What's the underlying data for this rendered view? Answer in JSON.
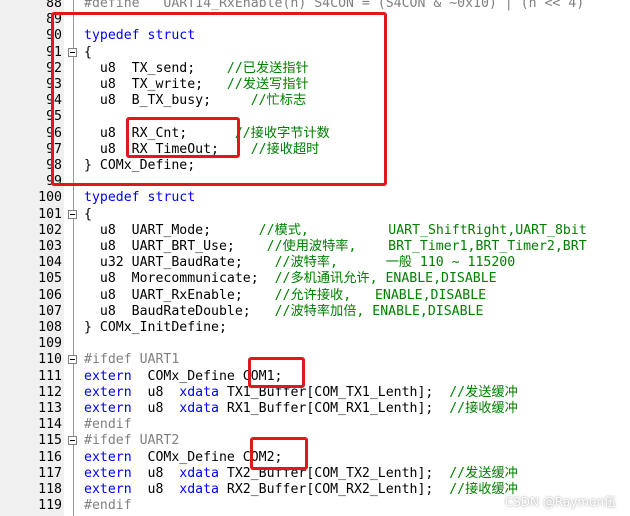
{
  "editor": {
    "lines": [
      {
        "num": "88",
        "fold": false,
        "segs": [
          {
            "t": "#define   UART14_RxEnable(n) S4CON = (S4CON & ~0x10) | (n << 4)",
            "c": "pp"
          }
        ]
      },
      {
        "num": "89",
        "fold": false,
        "segs": []
      },
      {
        "num": "90",
        "fold": false,
        "segs": [
          {
            "t": "typedef struct",
            "c": "kw"
          }
        ]
      },
      {
        "num": "91",
        "fold": true,
        "segs": [
          {
            "t": "{",
            "c": ""
          }
        ]
      },
      {
        "num": "92",
        "fold": false,
        "segs": [
          {
            "t": "  u8  TX_send;    ",
            "c": ""
          },
          {
            "t": "//已发送指针",
            "c": "cmt"
          }
        ]
      },
      {
        "num": "93",
        "fold": false,
        "segs": [
          {
            "t": "  u8  TX_write;   ",
            "c": ""
          },
          {
            "t": "//发送写指针",
            "c": "cmt"
          }
        ]
      },
      {
        "num": "94",
        "fold": false,
        "segs": [
          {
            "t": "  u8  B_TX_busy;     ",
            "c": ""
          },
          {
            "t": "//忙标志",
            "c": "cmt"
          }
        ]
      },
      {
        "num": "95",
        "fold": false,
        "segs": []
      },
      {
        "num": "96",
        "fold": false,
        "segs": [
          {
            "t": "  u8  RX_Cnt;      ",
            "c": ""
          },
          {
            "t": "//接收字节计数",
            "c": "cmt"
          }
        ]
      },
      {
        "num": "97",
        "fold": false,
        "segs": [
          {
            "t": "  u8  RX_TimeOut;    ",
            "c": ""
          },
          {
            "t": "//接收超时",
            "c": "cmt"
          }
        ]
      },
      {
        "num": "98",
        "fold": false,
        "segs": [
          {
            "t": "} COMx_Define;",
            "c": ""
          }
        ]
      },
      {
        "num": "99",
        "fold": false,
        "segs": []
      },
      {
        "num": "100",
        "fold": false,
        "segs": [
          {
            "t": "typedef struct",
            "c": "kw"
          }
        ]
      },
      {
        "num": "101",
        "fold": true,
        "segs": [
          {
            "t": "{",
            "c": ""
          }
        ]
      },
      {
        "num": "102",
        "fold": false,
        "segs": [
          {
            "t": "  u8  UART_Mode;      ",
            "c": ""
          },
          {
            "t": "//模式,          UART_ShiftRight,UART_8bit",
            "c": "cmt"
          }
        ]
      },
      {
        "num": "103",
        "fold": false,
        "segs": [
          {
            "t": "  u8  UART_BRT_Use;    ",
            "c": ""
          },
          {
            "t": "//使用波特率,    BRT_Timer1,BRT_Timer2,BRT",
            "c": "cmt"
          }
        ]
      },
      {
        "num": "104",
        "fold": false,
        "segs": [
          {
            "t": "  u32 UART_BaudRate;    ",
            "c": ""
          },
          {
            "t": "//波特率,      一般 110 ~ 115200",
            "c": "cmt"
          }
        ]
      },
      {
        "num": "105",
        "fold": false,
        "segs": [
          {
            "t": "  u8  Morecommunicate;  ",
            "c": ""
          },
          {
            "t": "//多机通讯允许, ENABLE,DISABLE",
            "c": "cmt"
          }
        ]
      },
      {
        "num": "106",
        "fold": false,
        "segs": [
          {
            "t": "  u8  UART_RxEnable;    ",
            "c": ""
          },
          {
            "t": "//允许接收,   ENABLE,DISABLE",
            "c": "cmt"
          }
        ]
      },
      {
        "num": "107",
        "fold": false,
        "segs": [
          {
            "t": "  u8  BaudRateDouble;   ",
            "c": ""
          },
          {
            "t": "//波特率加倍, ENABLE,DISABLE",
            "c": "cmt"
          }
        ]
      },
      {
        "num": "108",
        "fold": false,
        "segs": [
          {
            "t": "} COMx_InitDefine;",
            "c": ""
          }
        ]
      },
      {
        "num": "109",
        "fold": false,
        "segs": []
      },
      {
        "num": "110",
        "fold": true,
        "segs": [
          {
            "t": "#ifdef UART1",
            "c": "pp"
          }
        ]
      },
      {
        "num": "111",
        "fold": false,
        "segs": [
          {
            "t": "extern",
            "c": "kw"
          },
          {
            "t": "  COMx_Define COM1;",
            "c": ""
          }
        ]
      },
      {
        "num": "112",
        "fold": false,
        "segs": [
          {
            "t": "extern",
            "c": "kw"
          },
          {
            "t": "  u8  ",
            "c": ""
          },
          {
            "t": "xdata",
            "c": "kw"
          },
          {
            "t": " TX1_Buffer[COM_TX1_Lenth];  ",
            "c": ""
          },
          {
            "t": "//发送缓冲",
            "c": "cmt"
          }
        ]
      },
      {
        "num": "113",
        "fold": false,
        "segs": [
          {
            "t": "extern",
            "c": "kw"
          },
          {
            "t": "  u8  ",
            "c": ""
          },
          {
            "t": "xdata",
            "c": "kw"
          },
          {
            "t": " RX1_Buffer[COM_RX1_Lenth];  ",
            "c": ""
          },
          {
            "t": "//接收缓冲",
            "c": "cmt"
          }
        ]
      },
      {
        "num": "114",
        "fold": false,
        "segs": [
          {
            "t": "#endif",
            "c": "pp"
          }
        ]
      },
      {
        "num": "115",
        "fold": true,
        "segs": [
          {
            "t": "#ifdef UART2",
            "c": "pp"
          }
        ]
      },
      {
        "num": "116",
        "fold": false,
        "segs": [
          {
            "t": "extern",
            "c": "kw"
          },
          {
            "t": "  COMx_Define COM2;",
            "c": ""
          }
        ]
      },
      {
        "num": "117",
        "fold": false,
        "segs": [
          {
            "t": "extern",
            "c": "kw"
          },
          {
            "t": "  u8  ",
            "c": ""
          },
          {
            "t": "xdata",
            "c": "kw"
          },
          {
            "t": " TX2_Buffer[COM_TX2_Lenth];  ",
            "c": ""
          },
          {
            "t": "//发送缓冲",
            "c": "cmt"
          }
        ]
      },
      {
        "num": "118",
        "fold": false,
        "segs": [
          {
            "t": "extern",
            "c": "kw"
          },
          {
            "t": "  u8  ",
            "c": ""
          },
          {
            "t": "xdata",
            "c": "kw"
          },
          {
            "t": " RX2_Buffer[COM_RX2_Lenth];  ",
            "c": ""
          },
          {
            "t": "//接收缓冲",
            "c": "cmt"
          }
        ]
      },
      {
        "num": "119",
        "fold": false,
        "segs": [
          {
            "t": "#endif",
            "c": "pp"
          }
        ]
      }
    ]
  },
  "annotations": {
    "color": "#e0181b",
    "labels": [
      "struct-definition",
      "rx-fields",
      "com1-variable",
      "com2-variable"
    ]
  },
  "watermark": "CSDN @Raymon伍"
}
